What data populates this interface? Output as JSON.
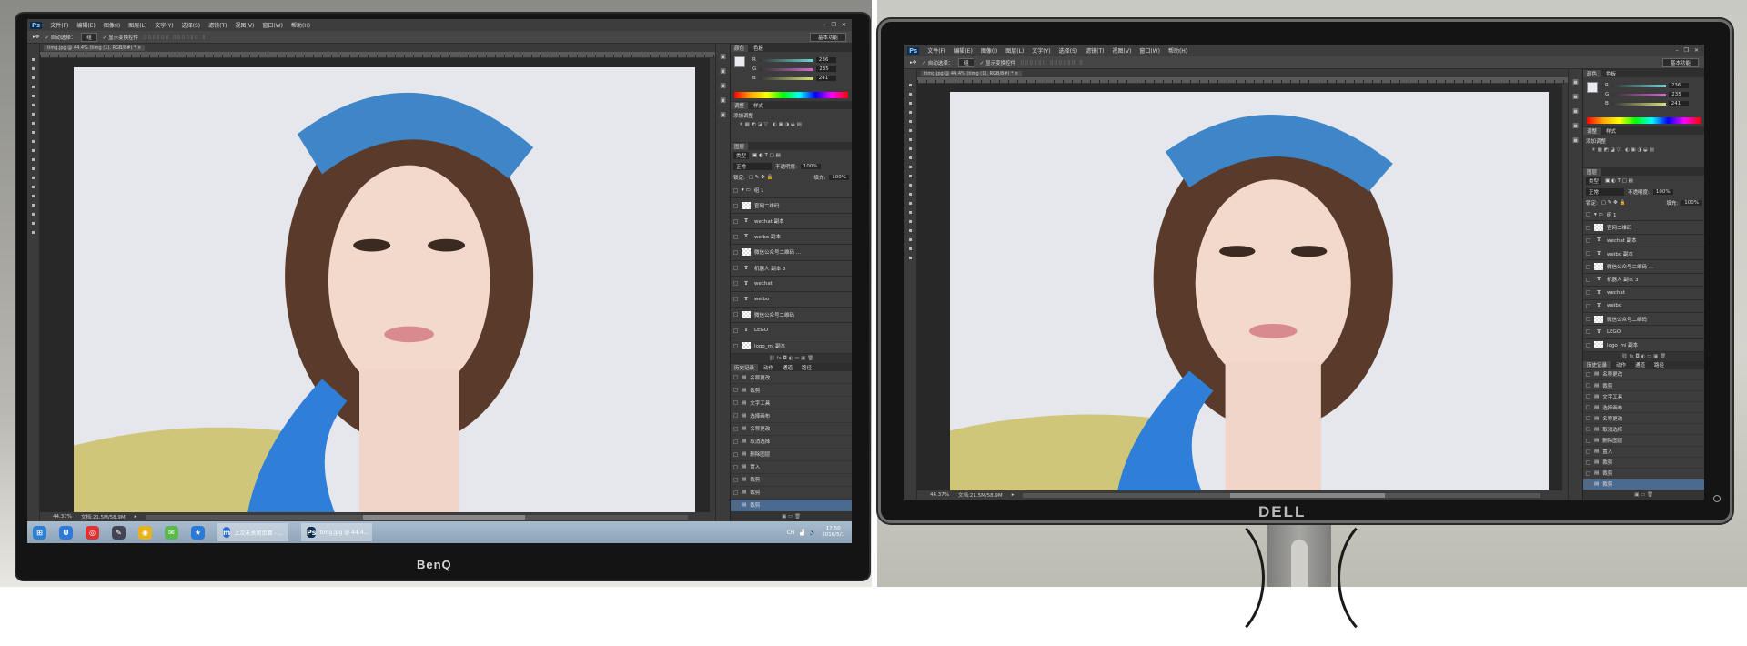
{
  "photoshop": {
    "logo": "Ps",
    "menu": [
      "文件(F)",
      "编辑(E)",
      "图像(I)",
      "图层(L)",
      "文字(Y)",
      "选择(S)",
      "滤镜(T)",
      "视图(V)",
      "窗口(W)",
      "帮助(H)"
    ],
    "window_controls": [
      "–",
      "❐",
      "✕"
    ],
    "options": {
      "auto_select_label": "自动选择：",
      "auto_select_value": "组",
      "show_transform_label": "显示变换控件",
      "workspace": "基本功能"
    },
    "doc_tab": "timg.jpg @ 44.4% (timg (1), RGB/8#) *",
    "doc_tab_close": "×",
    "color_panel": {
      "tabs": [
        "颜色",
        "色板"
      ],
      "channels": [
        {
          "label": "R",
          "value": "236",
          "color": "#6fd6d0"
        },
        {
          "label": "G",
          "value": "235",
          "color": "#d46ad0"
        },
        {
          "label": "B",
          "value": "241",
          "color": "#d8e07a"
        }
      ]
    },
    "adjust_panel": {
      "tabs": [
        "调整",
        "样式"
      ],
      "title": "添加调整"
    },
    "layers_panel": {
      "tab": "图层",
      "filter": "类型",
      "blend_mode": "正常",
      "opacity_label": "不透明度:",
      "opacity": "100%",
      "lock_label": "锁定:",
      "fill_label": "填充:",
      "fill": "100%",
      "layers": [
        {
          "name": "组 1",
          "kind": "group"
        },
        {
          "name": "官网二维码",
          "kind": "image"
        },
        {
          "name": "wechat 副本",
          "kind": "text"
        },
        {
          "name": "weibo 副本",
          "kind": "text"
        },
        {
          "name": "微信公众号二维码 ...",
          "kind": "image"
        },
        {
          "name": "机器人 副本 3",
          "kind": "text"
        },
        {
          "name": "wechat",
          "kind": "text"
        },
        {
          "name": "weibo",
          "kind": "text"
        },
        {
          "name": "微信公众号二维码",
          "kind": "image"
        },
        {
          "name": "LEGO",
          "kind": "text"
        },
        {
          "name": "logo_mi 副本",
          "kind": "image"
        }
      ]
    },
    "history_panel": {
      "tabs": [
        "历史记录",
        "动作",
        "通道",
        "路径"
      ],
      "items": [
        "名称更改",
        "裁剪",
        "文字工具",
        "选择画布",
        "名称更改",
        "取消选择",
        "删除图层",
        "置入",
        "裁剪",
        "裁剪",
        "裁剪"
      ]
    },
    "status": {
      "zoom": "44.37%",
      "doc_size": "文档:21.5M/58.9M"
    }
  },
  "taskbar": {
    "apps": [
      {
        "name": "start",
        "color": "#2d7fd0",
        "glyph": "⊞"
      },
      {
        "name": "security",
        "color": "#2f7ad8",
        "glyph": "U"
      },
      {
        "name": "netease-music",
        "color": "#d33",
        "glyph": "◎"
      },
      {
        "name": "pen",
        "color": "#445",
        "glyph": "✎"
      },
      {
        "name": "chrome",
        "color": "#e8b21c",
        "glyph": "◉"
      },
      {
        "name": "wechat",
        "color": "#5bb84a",
        "glyph": "✉"
      },
      {
        "name": "bookmark",
        "color": "#2979d6",
        "glyph": "★"
      }
    ],
    "windows": [
      {
        "icon": "m",
        "color": "#2a6fd0",
        "label": "上次未关闭页面 - ..."
      },
      {
        "icon": "Ps",
        "color": "#0b2d52",
        "label": "timg.jpg @ 44.4..."
      }
    ],
    "tray": {
      "ime": "CH",
      "time": "17:50",
      "date": "2016/5/1"
    }
  },
  "monitors": {
    "left_brand": "BenQ",
    "right_brand": "DELL"
  }
}
